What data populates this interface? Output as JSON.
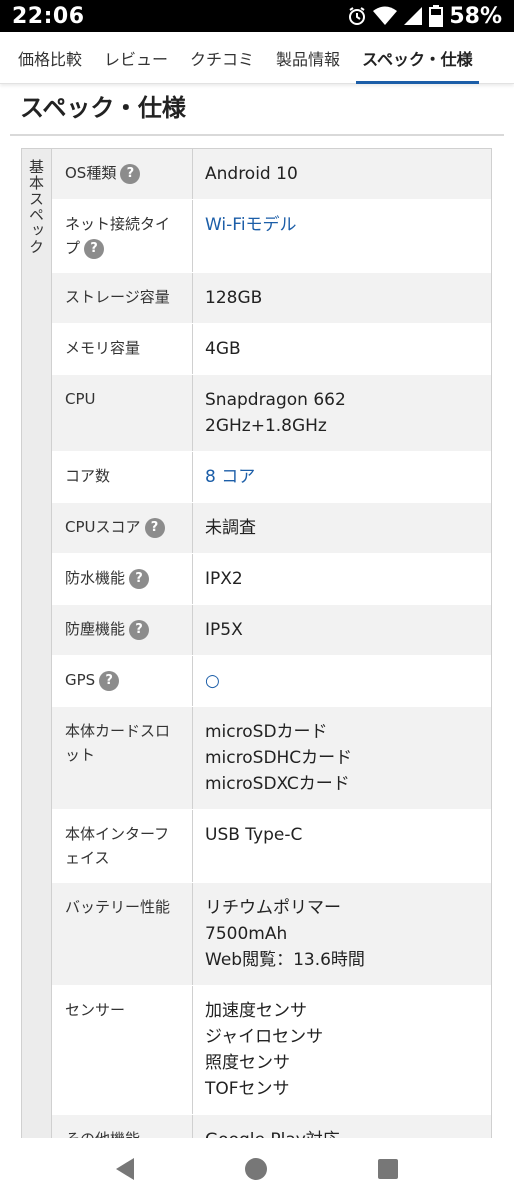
{
  "status_bar": {
    "time": "22:06",
    "battery": "58%",
    "icons": [
      "alarm-icon",
      "wifi-icon",
      "signal-icon",
      "battery-icon"
    ]
  },
  "tabs": [
    {
      "label": "価格比較",
      "active": false
    },
    {
      "label": "レビュー",
      "active": false
    },
    {
      "label": "クチコミ",
      "active": false
    },
    {
      "label": "製品情報",
      "active": false
    },
    {
      "label": "スペック・仕様",
      "active": true
    }
  ],
  "section": {
    "title": "スペック・仕様"
  },
  "spec": {
    "group_label": "基本スペック",
    "rows": [
      {
        "label": "OS種類",
        "help": true,
        "values": [
          "Android 10"
        ],
        "link": false
      },
      {
        "label": "ネット接続タイプ",
        "help": true,
        "values": [
          "Wi-Fiモデル"
        ],
        "link": true
      },
      {
        "label": "ストレージ容量",
        "help": false,
        "values": [
          "128GB"
        ],
        "link": false
      },
      {
        "label": "メモリ容量",
        "help": false,
        "values": [
          "4GB"
        ],
        "link": false
      },
      {
        "label": "CPU",
        "help": false,
        "values": [
          "Snapdragon 662",
          "2GHz+1.8GHz"
        ],
        "link": false
      },
      {
        "label": "コア数",
        "help": false,
        "values": [
          "8 コア"
        ],
        "link": true
      },
      {
        "label": "CPUスコア",
        "help": true,
        "values": [
          "未調査"
        ],
        "link": false
      },
      {
        "label": "防水機能",
        "help": true,
        "values": [
          "IPX2"
        ],
        "link": false
      },
      {
        "label": "防塵機能",
        "help": true,
        "values": [
          "IP5X"
        ],
        "link": false
      },
      {
        "label": "GPS",
        "help": true,
        "values": [
          "○"
        ],
        "link": true
      },
      {
        "label": "本体カードスロット",
        "help": false,
        "values": [
          "microSDカード",
          "microSDHCカード",
          "microSDXCカード"
        ],
        "link": false
      },
      {
        "label": "本体インターフェイス",
        "help": false,
        "values": [
          "USB Type-C"
        ],
        "link": false
      },
      {
        "label": "バッテリー性能",
        "help": false,
        "values": [
          "リチウムポリマー",
          "7500mAh",
          "Web閲覧：13.6時間"
        ],
        "link": false
      },
      {
        "label": "センサー",
        "help": false,
        "values": [
          "加速度センサ",
          "ジャイロセンサ",
          "照度センサ",
          "TOFセンサ"
        ],
        "link": false
      },
      {
        "label": "その他機能",
        "help": false,
        "values": [
          "Google Play対応"
        ],
        "link": false
      }
    ]
  },
  "help_glyph": "?",
  "colors": {
    "accent": "#1c5ea8",
    "help_badge": "#8c8c8c",
    "row_alt": "#f2f2f2"
  }
}
